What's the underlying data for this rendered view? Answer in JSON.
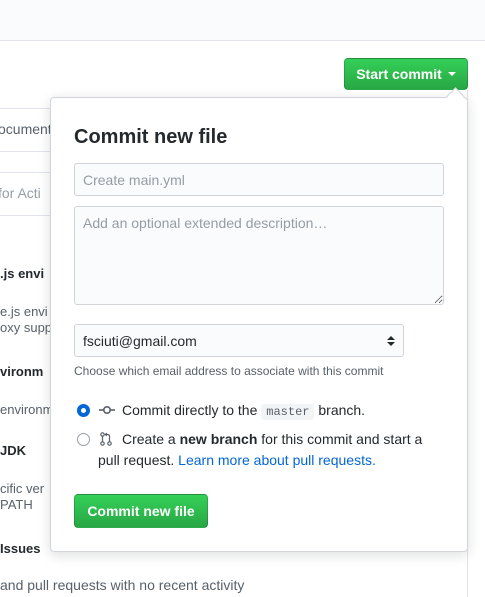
{
  "background": {
    "items": [
      {
        "text": "ocument",
        "bold": false
      },
      {
        "text": " for Acti",
        "bold": false
      },
      {
        "text": ".js envi",
        "bold": true
      },
      {
        "text": "e.js envi",
        "bold": false
      },
      {
        "text": "oxy supp",
        "bold": false
      },
      {
        "text": "vironm",
        "bold": true
      },
      {
        "text": "environm",
        "bold": false
      },
      {
        "text": "JDK",
        "bold": true
      },
      {
        "text": "cific ver",
        "bold": false
      },
      {
        "text": "PATH",
        "bold": false
      },
      {
        "text": "Issues",
        "bold": true
      },
      {
        "text": " and pull requests with no recent activity",
        "bold": false
      }
    ]
  },
  "header": {
    "start_commit_label": "Start commit"
  },
  "commit_popover": {
    "title": "Commit new file",
    "summary_placeholder": "Create main.yml",
    "description_placeholder": "Add an optional extended description…",
    "email_selected": "fsciuti@gmail.com",
    "email_note": "Choose which email address to associate with this commit",
    "option_direct": {
      "prefix": "Commit directly to the",
      "branch": "master",
      "suffix": "branch.",
      "checked": true
    },
    "option_new_branch": {
      "prefix": "Create a",
      "bold": "new branch",
      "middle": "for this commit and start a",
      "line2_prefix": "pull request.",
      "link": "Learn more about pull requests.",
      "checked": false
    },
    "submit_label": "Commit new file"
  },
  "colors": {
    "primary_green": "#28a745",
    "link_blue": "#0366d6",
    "border": "#d1d5da"
  }
}
